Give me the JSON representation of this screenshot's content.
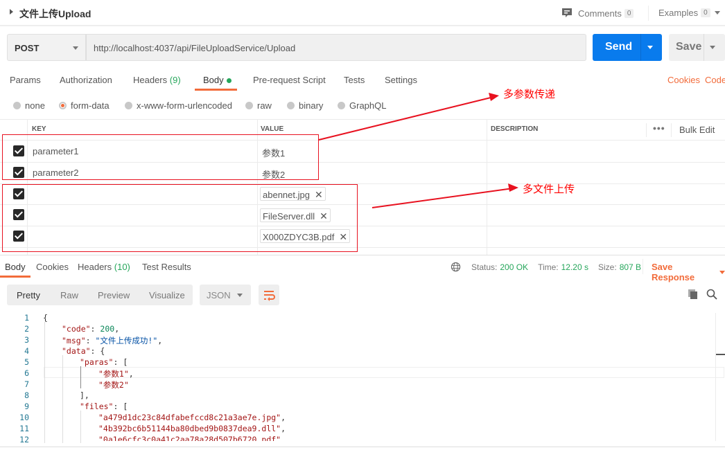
{
  "header": {
    "title": "文件上传Upload",
    "comments_label": "Comments",
    "comments_count": "0",
    "examples_label": "Examples",
    "examples_count": "0"
  },
  "request": {
    "method": "POST",
    "url": "http://localhost:4037/api/FileUploadService/Upload",
    "send_label": "Send",
    "save_label": "Save"
  },
  "request_tabs": {
    "params": "Params",
    "authorization": "Authorization",
    "headers": "Headers",
    "headers_count": "(9)",
    "body": "Body",
    "prerequest": "Pre-request Script",
    "tests": "Tests",
    "settings": "Settings",
    "cookies": "Cookies",
    "code": "Code"
  },
  "body_types": [
    "none",
    "form-data",
    "x-www-form-urlencoded",
    "raw",
    "binary",
    "GraphQL"
  ],
  "body_type_selected": "form-data",
  "table": {
    "headers": {
      "key": "KEY",
      "value": "VALUE",
      "description": "DESCRIPTION",
      "bulk_edit": "Bulk Edit"
    },
    "rows": [
      {
        "checked": true,
        "key": "parameter1",
        "value": "参数1",
        "type": "text"
      },
      {
        "checked": true,
        "key": "parameter2",
        "value": "参数2",
        "type": "text"
      },
      {
        "checked": true,
        "key": "",
        "value": "abennet.jpg",
        "type": "file"
      },
      {
        "checked": true,
        "key": "",
        "value": "FileServer.dll",
        "type": "file"
      },
      {
        "checked": true,
        "key": "",
        "value": "X000ZDYC3B.pdf",
        "type": "file"
      }
    ]
  },
  "annotations": {
    "multi_param": "多参数传递",
    "multi_file": "多文件上传",
    "color": "#e8111f"
  },
  "response": {
    "tabs": {
      "body": "Body",
      "cookies": "Cookies",
      "headers": "Headers",
      "headers_count": "(10)",
      "test_results": "Test Results"
    },
    "status_label": "Status:",
    "status_value": "200 OK",
    "time_label": "Time:",
    "time_value": "12.20 s",
    "size_label": "Size:",
    "size_value": "807 B",
    "save_response": "Save Response",
    "formats": [
      "Pretty",
      "Raw",
      "Preview",
      "Visualize"
    ],
    "language": "JSON",
    "code_lines": [
      {
        "n": "1"
      },
      {
        "n": "2"
      },
      {
        "n": "3"
      },
      {
        "n": "4"
      },
      {
        "n": "5"
      },
      {
        "n": "6"
      },
      {
        "n": "7"
      },
      {
        "n": "8"
      },
      {
        "n": "9"
      },
      {
        "n": "10"
      },
      {
        "n": "11"
      },
      {
        "n": "12"
      }
    ],
    "json": {
      "code_key": "\"code\"",
      "code_val": "200",
      "msg_key": "\"msg\"",
      "msg_val": "\"文件上传成功!\"",
      "data_key": "\"data\"",
      "paras_key": "\"paras\"",
      "para1": "\"参数1\"",
      "para2": "\"参数2\"",
      "files_key": "\"files\"",
      "file1": "\"a479d1dc23c84dfabefccd8c21a3ae7e.jpg\"",
      "file2": "\"4b392bc6b51144ba80dbed9b0837dea9.dll\"",
      "file3": "\"0a1e6cfc3c0a41c2aa78a28d507b6720.pdf\""
    }
  },
  "colors": {
    "accent": "#f26b3a",
    "send": "#097bed",
    "success": "#26a65b"
  }
}
